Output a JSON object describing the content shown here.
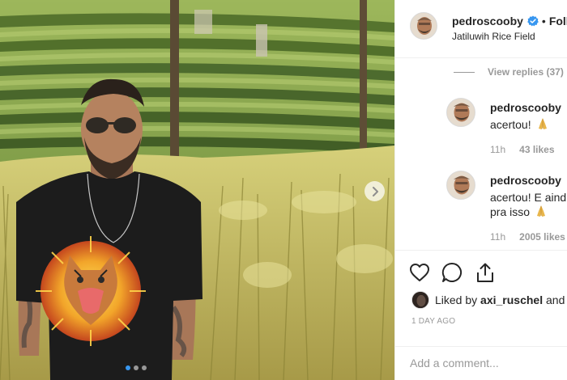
{
  "photo": {
    "alt_icon_next": "chevron-right-icon",
    "carousel_dots": 3,
    "carousel_active_index": 0
  },
  "header": {
    "username": "pedroscooby",
    "separator": "•",
    "follow_label": "Foll",
    "location": "Jatiluwih Rice Field"
  },
  "view_replies": "View replies (37)",
  "comments": [
    {
      "username": "pedroscooby",
      "lines": [
        "acertou!"
      ],
      "time": "11h",
      "likes": "43 likes"
    },
    {
      "username": "pedroscooby",
      "lines": [
        "acertou! E aind",
        "pra isso"
      ],
      "time": "11h",
      "likes": "2005 likes"
    }
  ],
  "actions": {
    "icons": [
      "heart-icon",
      "comment-icon",
      "share-icon"
    ]
  },
  "liked_by": {
    "prefix": "Liked by ",
    "user": "axi_ruschel",
    "suffix": " and"
  },
  "time_ago": "1 DAY AGO",
  "add_comment": {
    "placeholder": "Add a comment..."
  },
  "colors": {
    "verified_blue": "#3897f0",
    "muted": "#999999",
    "text": "#262626",
    "border": "#efefef"
  }
}
